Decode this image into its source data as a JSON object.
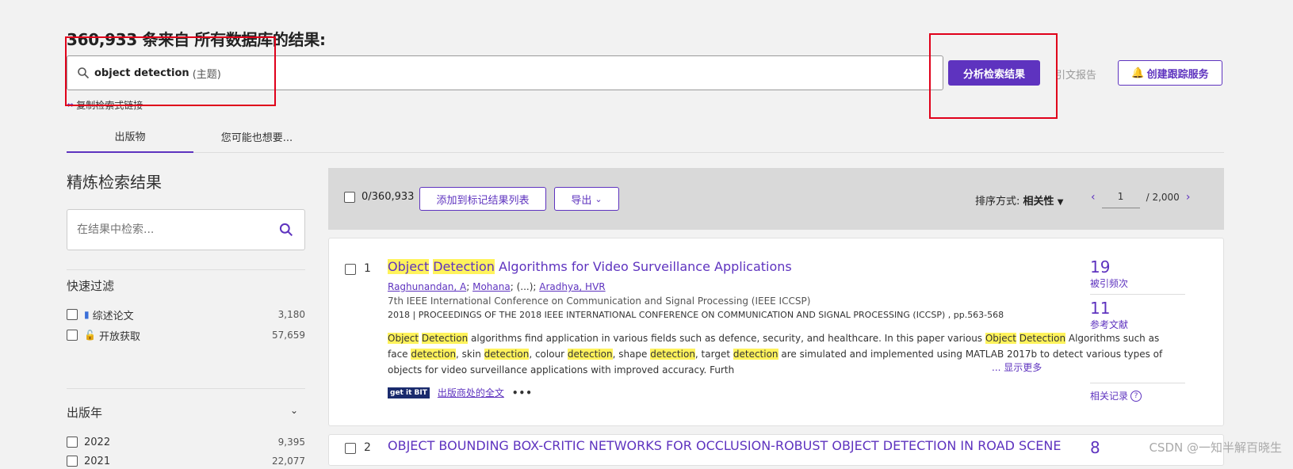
{
  "header": {
    "count": "360,933",
    "suffix": "条来自 所有数据库的结果:"
  },
  "search": {
    "query": "object detection",
    "query_type": "(主题)"
  },
  "actions": {
    "analyze_label": "分析检索结果",
    "citation_report_label": "引文报告",
    "alert_label": "创建跟踪服务",
    "copy_link_label": "复制检索式链接"
  },
  "tabs": [
    {
      "label": "出版物"
    },
    {
      "label": "您可能也想要..."
    }
  ],
  "refine": {
    "title": "精炼检索结果",
    "search_placeholder": "在结果中检索...",
    "quick_filter_title": "快速过滤",
    "quick_filters": [
      {
        "label": "综述论文",
        "count": "3,180"
      },
      {
        "label": "开放获取",
        "count": "57,659"
      }
    ],
    "year_title": "出版年",
    "years": [
      {
        "label": "2022",
        "count": "9,395"
      },
      {
        "label": "2021",
        "count": "22,077"
      }
    ]
  },
  "toolbar": {
    "selected": "0/360,933",
    "add_to_marked": "添加到标记结果列表",
    "export": "导出",
    "sort_label": "排序方式:",
    "sort_value": "相关性",
    "page": "1",
    "total_pages": "/ 2,000"
  },
  "results": [
    {
      "num": "1",
      "title_parts": [
        "Object",
        "Detection",
        "Algorithms for Video Surveillance Applications"
      ],
      "authors": [
        "Raghunandan, A",
        "Mohana",
        "(...)",
        "Aradhya, HVR"
      ],
      "conference": "7th IEEE International Conference on Communication and Signal Processing (IEEE ICCSP)",
      "pubinfo": "2018 | PROCEEDINGS OF THE 2018 IEEE INTERNATIONAL CONFERENCE ON COMMUNICATION AND SIGNAL PROCESSING (ICCSP) , pp.563-568",
      "abstract_line3": "various types of objects for video surveillance applications with improved accuracy. Furth",
      "show_more": "... 显示更多",
      "getit": "get it BIT",
      "fulltext": "出版商处的全文",
      "citations": "19",
      "citations_label": "被引频次",
      "references": "11",
      "references_label": "参考文献",
      "related": "相关记录"
    },
    {
      "num": "2",
      "title": "OBJECT BOUNDING BOX-CRITIC NETWORKS FOR OCCLUSION-ROBUST OBJECT DETECTION IN ROAD SCENE",
      "citations": "8"
    }
  ],
  "watermark": "CSDN @一知半解百晓生",
  "colors": {
    "accent": "#5e33bf",
    "highlight": "#fff35c",
    "annotation_red": "#e0001a"
  }
}
